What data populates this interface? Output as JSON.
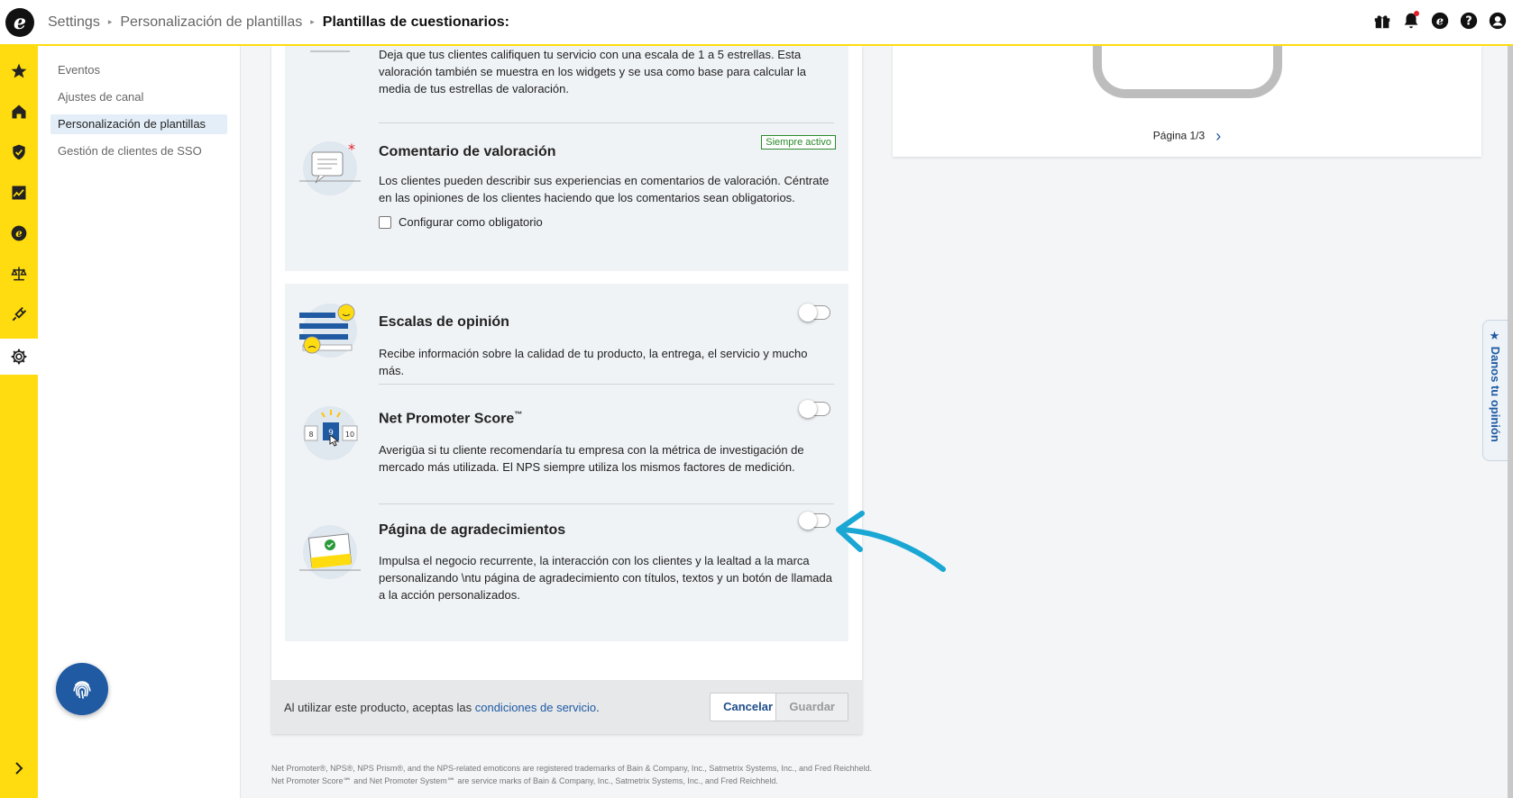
{
  "topbar": {
    "breadcrumb": [
      "Settings",
      "Personalización de plantillas",
      "Plantillas de cuestionarios:"
    ],
    "icons": [
      "gift-icon",
      "bell-icon",
      "etrusted-icon",
      "help-icon",
      "account-icon"
    ]
  },
  "rail": {
    "icons": [
      "star-icon",
      "home-icon",
      "shield-icon",
      "chart-icon",
      "etrusted-icon",
      "balance-icon",
      "plug-icon",
      "gear-icon"
    ],
    "active": "gear-icon"
  },
  "subnav": {
    "items": [
      {
        "label": "Eventos"
      },
      {
        "label": "Ajustes de canal"
      },
      {
        "label": "Personalización de plantillas"
      },
      {
        "label": "Gestión de clientes de SSO"
      }
    ]
  },
  "sections": {
    "rating": {
      "description": "Deja que tus clientes califiquen tu servicio con una escala de 1 a 5 estrellas. Esta valoración también se muestra en los widgets y se usa como base para calcular la media de tus estrellas de valoración."
    },
    "comment": {
      "title": "Comentario de valoración",
      "badge": "Siempre activo",
      "description": "Los clientes pueden describir sus experiencias en comentarios de valoración. Céntrate en las opiniones de los clientes haciendo que los comentarios sean obligatorios.",
      "checkbox_label": "Configurar como obligatorio"
    },
    "opinion_scales": {
      "title": "Escalas de opinión",
      "description": "Recibe información sobre la calidad de tu producto, la entrega, el servicio y mucho más.",
      "enabled": false
    },
    "nps": {
      "title": "Net Promoter Score",
      "tm": "™",
      "description": "Averigüa si tu cliente recomendaría tu empresa con la métrica de investigación de mercado más utilizada. El NPS siempre utiliza los mismos factores de medición.",
      "enabled": false,
      "scale_labels": [
        "8",
        "9",
        "10"
      ]
    },
    "thanks_page": {
      "title": "Página de agradecimientos",
      "description": "Impulsa el negocio recurrente, la interacción con los clientes y la lealtad a la marca personalizando \\ntu página de agradecimiento con títulos, textos y un botón de llamada a la acción personalizados.",
      "enabled": false
    }
  },
  "footer": {
    "terms_prefix": "Al utilizar este producto, aceptas las ",
    "terms_link": "condiciones de servicio",
    "terms_suffix": ".",
    "cancel_label": "Cancelar",
    "save_label": "Guardar"
  },
  "disclaimer": "Net Promoter®, NPS®, NPS Prism®, and the NPS-related emoticons are registered trademarks of Bain & Company, Inc., Satmetrix Systems, Inc., and Fred Reichheld. Net Promoter Score℠ and Net Promoter System℠ are service marks of Bain & Company, Inc., Satmetrix Systems, Inc., and Fred Reichheld.",
  "preview": {
    "pager": "Página 1/3"
  },
  "feedback_tab": "★ Danos tu opinión",
  "colors": {
    "accent_yellow": "#ffdc0f",
    "link_blue": "#1f5aa3",
    "annotation_arrow": "#1aa7d4"
  }
}
